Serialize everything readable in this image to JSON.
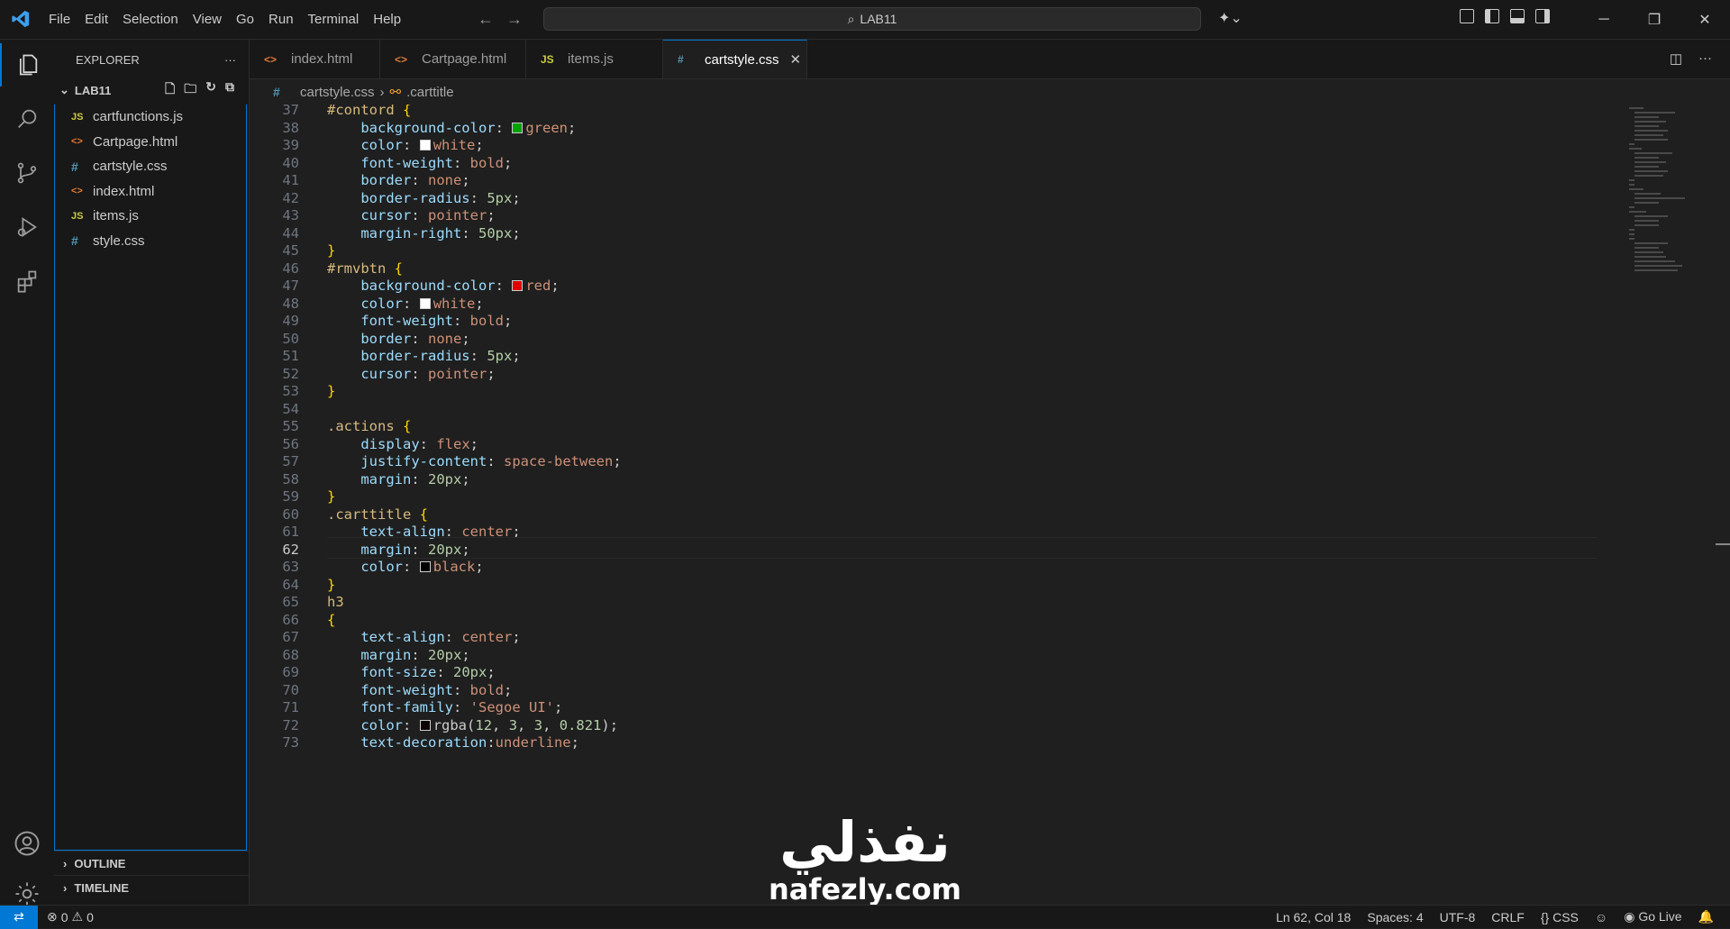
{
  "menu": [
    "File",
    "Edit",
    "Selection",
    "View",
    "Go",
    "Run",
    "Terminal",
    "Help"
  ],
  "search": {
    "label": "LAB11"
  },
  "explorer": {
    "title": "EXPLORER",
    "root": "LAB11",
    "files": [
      {
        "name": "cartfunctions.js",
        "icon": "JS",
        "type": "js"
      },
      {
        "name": "Cartpage.html",
        "icon": "<>",
        "type": "html"
      },
      {
        "name": "cartstyle.css",
        "icon": "#",
        "type": "css"
      },
      {
        "name": "index.html",
        "icon": "<>",
        "type": "html"
      },
      {
        "name": "items.js",
        "icon": "JS",
        "type": "js"
      },
      {
        "name": "style.css",
        "icon": "#",
        "type": "css"
      }
    ],
    "outline": "OUTLINE",
    "timeline": "TIMELINE"
  },
  "tabs": [
    {
      "label": "index.html",
      "icon": "<>",
      "type": "html"
    },
    {
      "label": "Cartpage.html",
      "icon": "<>",
      "type": "html"
    },
    {
      "label": "items.js",
      "icon": "JS",
      "type": "js"
    },
    {
      "label": "cartstyle.css",
      "icon": "#",
      "type": "css",
      "active": true
    }
  ],
  "breadcrumb": {
    "file": "cartstyle.css",
    "symbol": ".carttitle"
  },
  "editor": {
    "current_line": 62,
    "lines": [
      {
        "n": 37,
        "t": "#contord {"
      },
      {
        "n": 38,
        "t": "    background-color: green;"
      },
      {
        "n": 39,
        "t": "    color: white;"
      },
      {
        "n": 40,
        "t": "    font-weight: bold;"
      },
      {
        "n": 41,
        "t": "    border: none;"
      },
      {
        "n": 42,
        "t": "    border-radius: 5px;"
      },
      {
        "n": 43,
        "t": "    cursor: pointer;"
      },
      {
        "n": 44,
        "t": "    margin-right: 50px;"
      },
      {
        "n": 45,
        "t": "}"
      },
      {
        "n": 46,
        "t": "#rmvbtn {"
      },
      {
        "n": 47,
        "t": "    background-color: red;"
      },
      {
        "n": 48,
        "t": "    color: white;"
      },
      {
        "n": 49,
        "t": "    font-weight: bold;"
      },
      {
        "n": 50,
        "t": "    border: none;"
      },
      {
        "n": 51,
        "t": "    border-radius: 5px;"
      },
      {
        "n": 52,
        "t": "    cursor: pointer;"
      },
      {
        "n": 53,
        "t": "}"
      },
      {
        "n": 54,
        "t": ""
      },
      {
        "n": 55,
        "t": ".actions {"
      },
      {
        "n": 56,
        "t": "    display: flex;"
      },
      {
        "n": 57,
        "t": "    justify-content: space-between;"
      },
      {
        "n": 58,
        "t": "    margin: 20px;"
      },
      {
        "n": 59,
        "t": "}"
      },
      {
        "n": 60,
        "t": ".carttitle {"
      },
      {
        "n": 61,
        "t": "    text-align: center;"
      },
      {
        "n": 62,
        "t": "    margin: 20px;"
      },
      {
        "n": 63,
        "t": "    color: black;"
      },
      {
        "n": 64,
        "t": "}"
      },
      {
        "n": 65,
        "t": "h3"
      },
      {
        "n": 66,
        "t": "{"
      },
      {
        "n": 67,
        "t": "    text-align: center;"
      },
      {
        "n": 68,
        "t": "    margin: 20px;"
      },
      {
        "n": 69,
        "t": "    font-size: 20px;"
      },
      {
        "n": 70,
        "t": "    font-weight: bold;"
      },
      {
        "n": 71,
        "t": "    font-family: 'Segoe UI';"
      },
      {
        "n": 72,
        "t": "    color: rgba(12, 3, 3, 0.821);"
      },
      {
        "n": 73,
        "t": "    text-decoration:underline;"
      }
    ],
    "swatches": {
      "green": "#00a000",
      "red": "#e00000",
      "white": "#ffffff",
      "black": "#000000",
      "rgba": "#0c0303"
    }
  },
  "watermark": {
    "arabic": "نفذلي",
    "latin": "nafezly.com"
  },
  "status": {
    "errors": "0",
    "warnings": "0",
    "position": "Ln 62, Col 18",
    "spaces": "Spaces: 4",
    "encoding": "UTF-8",
    "eol": "CRLF",
    "language": "CSS",
    "golive": "Go Live"
  },
  "colors": {
    "accent": "#0078d4"
  }
}
